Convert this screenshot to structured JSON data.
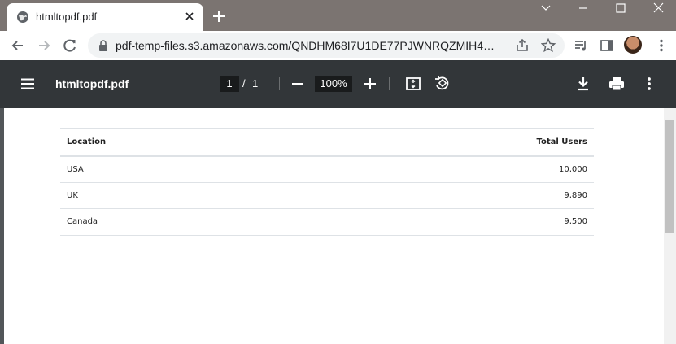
{
  "browser": {
    "tab": {
      "title": "htmltopdf.pdf",
      "favicon": "globe-icon"
    },
    "url": "pdf-temp-files.s3.amazonaws.com/QNDHM68I7U1DE77PJWNRQZMIH4CJF..."
  },
  "pdf_viewer": {
    "title": "htmltopdf.pdf",
    "current_page": "1",
    "page_separator": "/",
    "total_pages": "1",
    "zoom": "100%"
  },
  "document": {
    "table": {
      "headers": [
        "Location",
        "Total Users"
      ],
      "rows": [
        [
          "USA",
          "10,000"
        ],
        [
          "UK",
          "9,890"
        ],
        [
          "Canada",
          "9,500"
        ]
      ]
    }
  }
}
